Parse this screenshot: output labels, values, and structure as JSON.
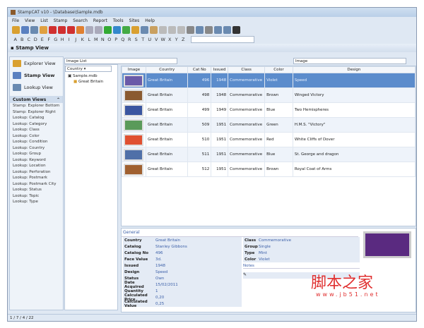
{
  "window": {
    "title": "StampCAT v10 - \\Database\\Sample.mdb"
  },
  "menu": [
    "File",
    "View",
    "List",
    "Stamp",
    "Search",
    "Report",
    "Tools",
    "Sites",
    "Help"
  ],
  "alphabet": [
    "A",
    "B",
    "C",
    "D",
    "E",
    "F",
    "G",
    "H",
    "I",
    "J",
    "K",
    "L",
    "M",
    "N",
    "O",
    "P",
    "Q",
    "R",
    "S",
    "T",
    "U",
    "V",
    "W",
    "X",
    "Y",
    "Z"
  ],
  "view_header": "Stamp View",
  "sidebar": {
    "nav": [
      {
        "label": "Explorer View",
        "color": "#d9a030"
      },
      {
        "label": "Stamp View",
        "color": "#5a80c0"
      },
      {
        "label": "Lookup View",
        "color": "#6a8ab0"
      }
    ],
    "custom_views_title": "Custom Views",
    "custom_views": [
      "Stamp: Explorer Bottom",
      "Stamp: Explorer Right",
      "Lookup: Catalog",
      "Lookup: Category",
      "Lookup: Class",
      "Lookup: Color",
      "Lookup: Condition",
      "Lookup: Country",
      "Lookup: Group",
      "Lookup: Keyword",
      "Lookup: Location",
      "Lookup: Perforation",
      "Lookup: Postmark",
      "Lookup: Postmark City",
      "Lookup: Status",
      "Lookup: Topic",
      "Lookup: Type"
    ]
  },
  "tree": {
    "group_by": "Country",
    "root": "Sample.mdb",
    "child": "Great Britain"
  },
  "list": {
    "mode": "Image List",
    "field": "Image"
  },
  "grid": {
    "columns": [
      "Image",
      "Country",
      "Cat No",
      "Issued",
      "Class",
      "Color",
      "Design"
    ],
    "rows": [
      {
        "country": "Great Britain",
        "catno": "496",
        "issued": "1948",
        "class": "Commemorative",
        "color": "Violet",
        "design": "Speed",
        "swatch": "#6a5aa8"
      },
      {
        "country": "Great Britain",
        "catno": "498",
        "issued": "1948",
        "class": "Commemorative",
        "color": "Brown",
        "design": "Winged Victory",
        "swatch": "#8a5a30"
      },
      {
        "country": "Great Britain",
        "catno": "499",
        "issued": "1949",
        "class": "Commemorative",
        "color": "Blue",
        "design": "Two Hemispheres",
        "swatch": "#3a55a0"
      },
      {
        "country": "Great Britain",
        "catno": "509",
        "issued": "1951",
        "class": "Commemorative",
        "color": "Green",
        "design": "H.M.S. \"Victory\"",
        "swatch": "#5a9a5a"
      },
      {
        "country": "Great Britain",
        "catno": "510",
        "issued": "1951",
        "class": "Commemorative",
        "color": "Red",
        "design": "White Cliffs of Dover",
        "swatch": "#e05030"
      },
      {
        "country": "Great Britain",
        "catno": "511",
        "issued": "1951",
        "class": "Commemorative",
        "color": "Blue",
        "design": "St. George and dragon",
        "swatch": "#5070a8"
      },
      {
        "country": "Great Britain",
        "catno": "512",
        "issued": "1951",
        "class": "Commemorative",
        "color": "Brown",
        "design": "Royal Coat of Arms",
        "swatch": "#a06030"
      }
    ]
  },
  "details": {
    "section": "General",
    "left": [
      [
        "Country",
        "Great Britain"
      ],
      [
        "Catalog",
        "Stanley Gibbons"
      ],
      [
        "Catalog No",
        "496"
      ],
      [
        "Face Value",
        "3d."
      ],
      [
        "Issued",
        "1948"
      ],
      [
        "Design",
        "Speed"
      ],
      [
        "Status",
        "Own"
      ],
      [
        "Date Acquired",
        "15/02/2011"
      ],
      [
        "Quantity",
        "1"
      ],
      [
        "Calculated Price",
        "0,20"
      ],
      [
        "Calculated Value",
        "0,25"
      ]
    ],
    "right": [
      [
        "Class",
        "Commemorative"
      ],
      [
        "Group",
        "Single"
      ],
      [
        "Type",
        "Mint"
      ],
      [
        "Color",
        "Violet"
      ]
    ],
    "notes_title": "Notes"
  },
  "status": "1 / 7 / 4 / 22",
  "watermark": {
    "line1": "脚本之家",
    "line2": "www.jb51.net"
  }
}
